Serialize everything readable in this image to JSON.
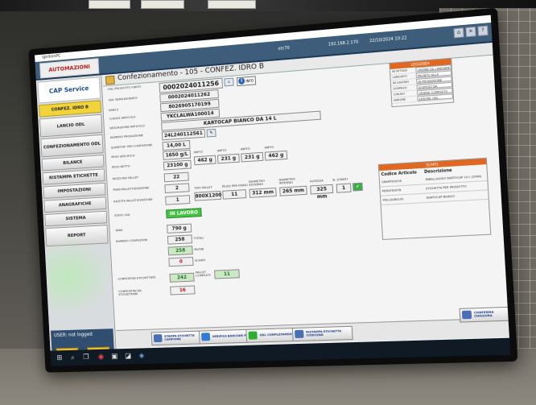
{
  "window": {
    "title": "IgnitionPC"
  },
  "topbar": {
    "logo": "AUTOMAZIONI",
    "user_id": "etc70",
    "ip": "192.168.2.170",
    "datetime": "22/10/2024 10:22",
    "buttons": [
      "⌂",
      "✕",
      "?"
    ]
  },
  "header": {
    "title": "Confezionamento - 105 - CONFEZ. IDRO B"
  },
  "sidebar": {
    "logo": "CAP Service",
    "items": [
      {
        "label": "CONFEZ. IDRO B",
        "active": true
      },
      {
        "label": "LANCIO ODL"
      },
      {
        "label": "CONFEZIONAMENTO ODL"
      },
      {
        "label": "BILANCE"
      },
      {
        "label": "RISTAMPA ETICHETTE"
      },
      {
        "label": "IMPOSTAZIONI"
      },
      {
        "label": "ANAGRAFICHE"
      },
      {
        "label": "SISTEMA"
      },
      {
        "label": "REPORT"
      }
    ],
    "user": "USER: not logged"
  },
  "form": {
    "odl_label": "ODL PRODOTTO FINITO",
    "odl_value": "0002024011256",
    "odl_sem_label": "ODL SEMILAVORATO",
    "odl_sem_value": "0002024011262",
    "ean_label": "EAN13",
    "ean_value": "8026905170199",
    "code_label": "CODICE ARTICOLO",
    "code_value": "YKCLALWA100014",
    "desc_label": "DESCRIZIONE ARTICOLO",
    "desc_value": "KARTOCAP BIANCO DA 14 L",
    "lot_label": "NUMERO PRODUZIONE",
    "lot_value": "24L240112561",
    "qty_label": "QUANTITA' PER CONFEZIONE",
    "qty_value": "14,00 L",
    "ps_label": "PESO SPECIFICO",
    "ps_value": "1650 g/L",
    "net_label": "PESO NETTO",
    "net_value": "23100 g",
    "tare_labels": [
      "IMPTO",
      "IMPTO",
      "IMPTO",
      "IMPTO"
    ],
    "tare_values": [
      "462 g",
      "231 g",
      "231 g",
      "462 g"
    ],
    "ppp_label": "PEZZI PER PALLET",
    "ppp_value": "22",
    "pal_label": "PIANI PALLETTIZZAZIONE",
    "pal_value": "2",
    "sch_label": "RICETTA PALLETIZZAZIONE",
    "sch_value": "1",
    "pallet_headers": [
      "TIPO PALLET",
      "PEZZI PER PIANO",
      "DIAMETRO ESTERNO",
      "DIAMETRO INTERNO",
      "ALTEZZA",
      "N. STRATI"
    ],
    "pallet_values": [
      "800X1200",
      "11",
      "312 mm",
      "265 mm",
      "325 mm",
      "1"
    ],
    "state_label": "STATO ODL",
    "state_value": "IN LAVORO",
    "tara_label": "TARA",
    "tara_value": "790 g",
    "conf_label": "NUMERO CONFEZIONI",
    "counts": [
      {
        "value": "258",
        "tag": "TOTALI"
      },
      {
        "value": "258",
        "tag": "BUONI"
      },
      {
        "value": "0",
        "tag": "SCARTI"
      }
    ],
    "etic_label": "CONFEZIONI ETICHETTATE",
    "etic_value": "242",
    "pallet_done_label": "PALLET COMPLETI",
    "pallet_done_value": "11",
    "rest_label": "CONFEZIONI DA ETICHETTARE",
    "rest_value": "16",
    "info_btn": "INFO"
  },
  "panel_right": {
    "title": "LEGGENDA",
    "rows": [
      [
        "IN ATTESA",
        "ORDINE DA LANCIARE"
      ],
      [
        "LANCIATO",
        "PRONTO ALLA PRODUZIONE"
      ],
      [
        "IN LAVORO",
        "IN PRODUZIONE"
      ],
      [
        "SOSPESO",
        "SOSPESO DA OPERATORE"
      ],
      [
        "CHIUSO",
        "ORDINE COMPLETO"
      ],
      [
        "ERRORE",
        "ERRORE ODL"
      ],
      [
        "ANNULLATO",
        "ANNULLATO"
      ]
    ]
  },
  "codes_table": {
    "title": "SCARTI",
    "col1": "Codice Articolo",
    "col2": "Descrizione",
    "rows": [
      [
        "GRAMTE0018",
        "IMBALLAGGIO KARTOCAP 14 L (STAN)"
      ],
      [
        "PEMATE0078",
        "ETICHETTA PER PRODOTTO"
      ],
      [
        "YKCLALWA100",
        "KARTOCAP BIANCO"
      ]
    ]
  },
  "actions": [
    {
      "label": "STAMPA ETICHETTA CAMPIONE",
      "color": "#4a6fb4"
    },
    {
      "label": "VERIFICA BARCODE PIENTI",
      "color": "#2d7bd4"
    },
    {
      "label": "ODL COMPLETAMENTO",
      "color": "#2fae2f"
    },
    {
      "label": "RISTAMPA ETICHETTA CODICEND",
      "color": "#4a6fb4"
    }
  ],
  "right_action": {
    "label": "CONFERMA CHIUSURA"
  },
  "colors": {
    "accent": "#f1d33a",
    "topbar": "#3d5d7a",
    "state_green": "#43c243",
    "panel_header": "#e06820"
  }
}
